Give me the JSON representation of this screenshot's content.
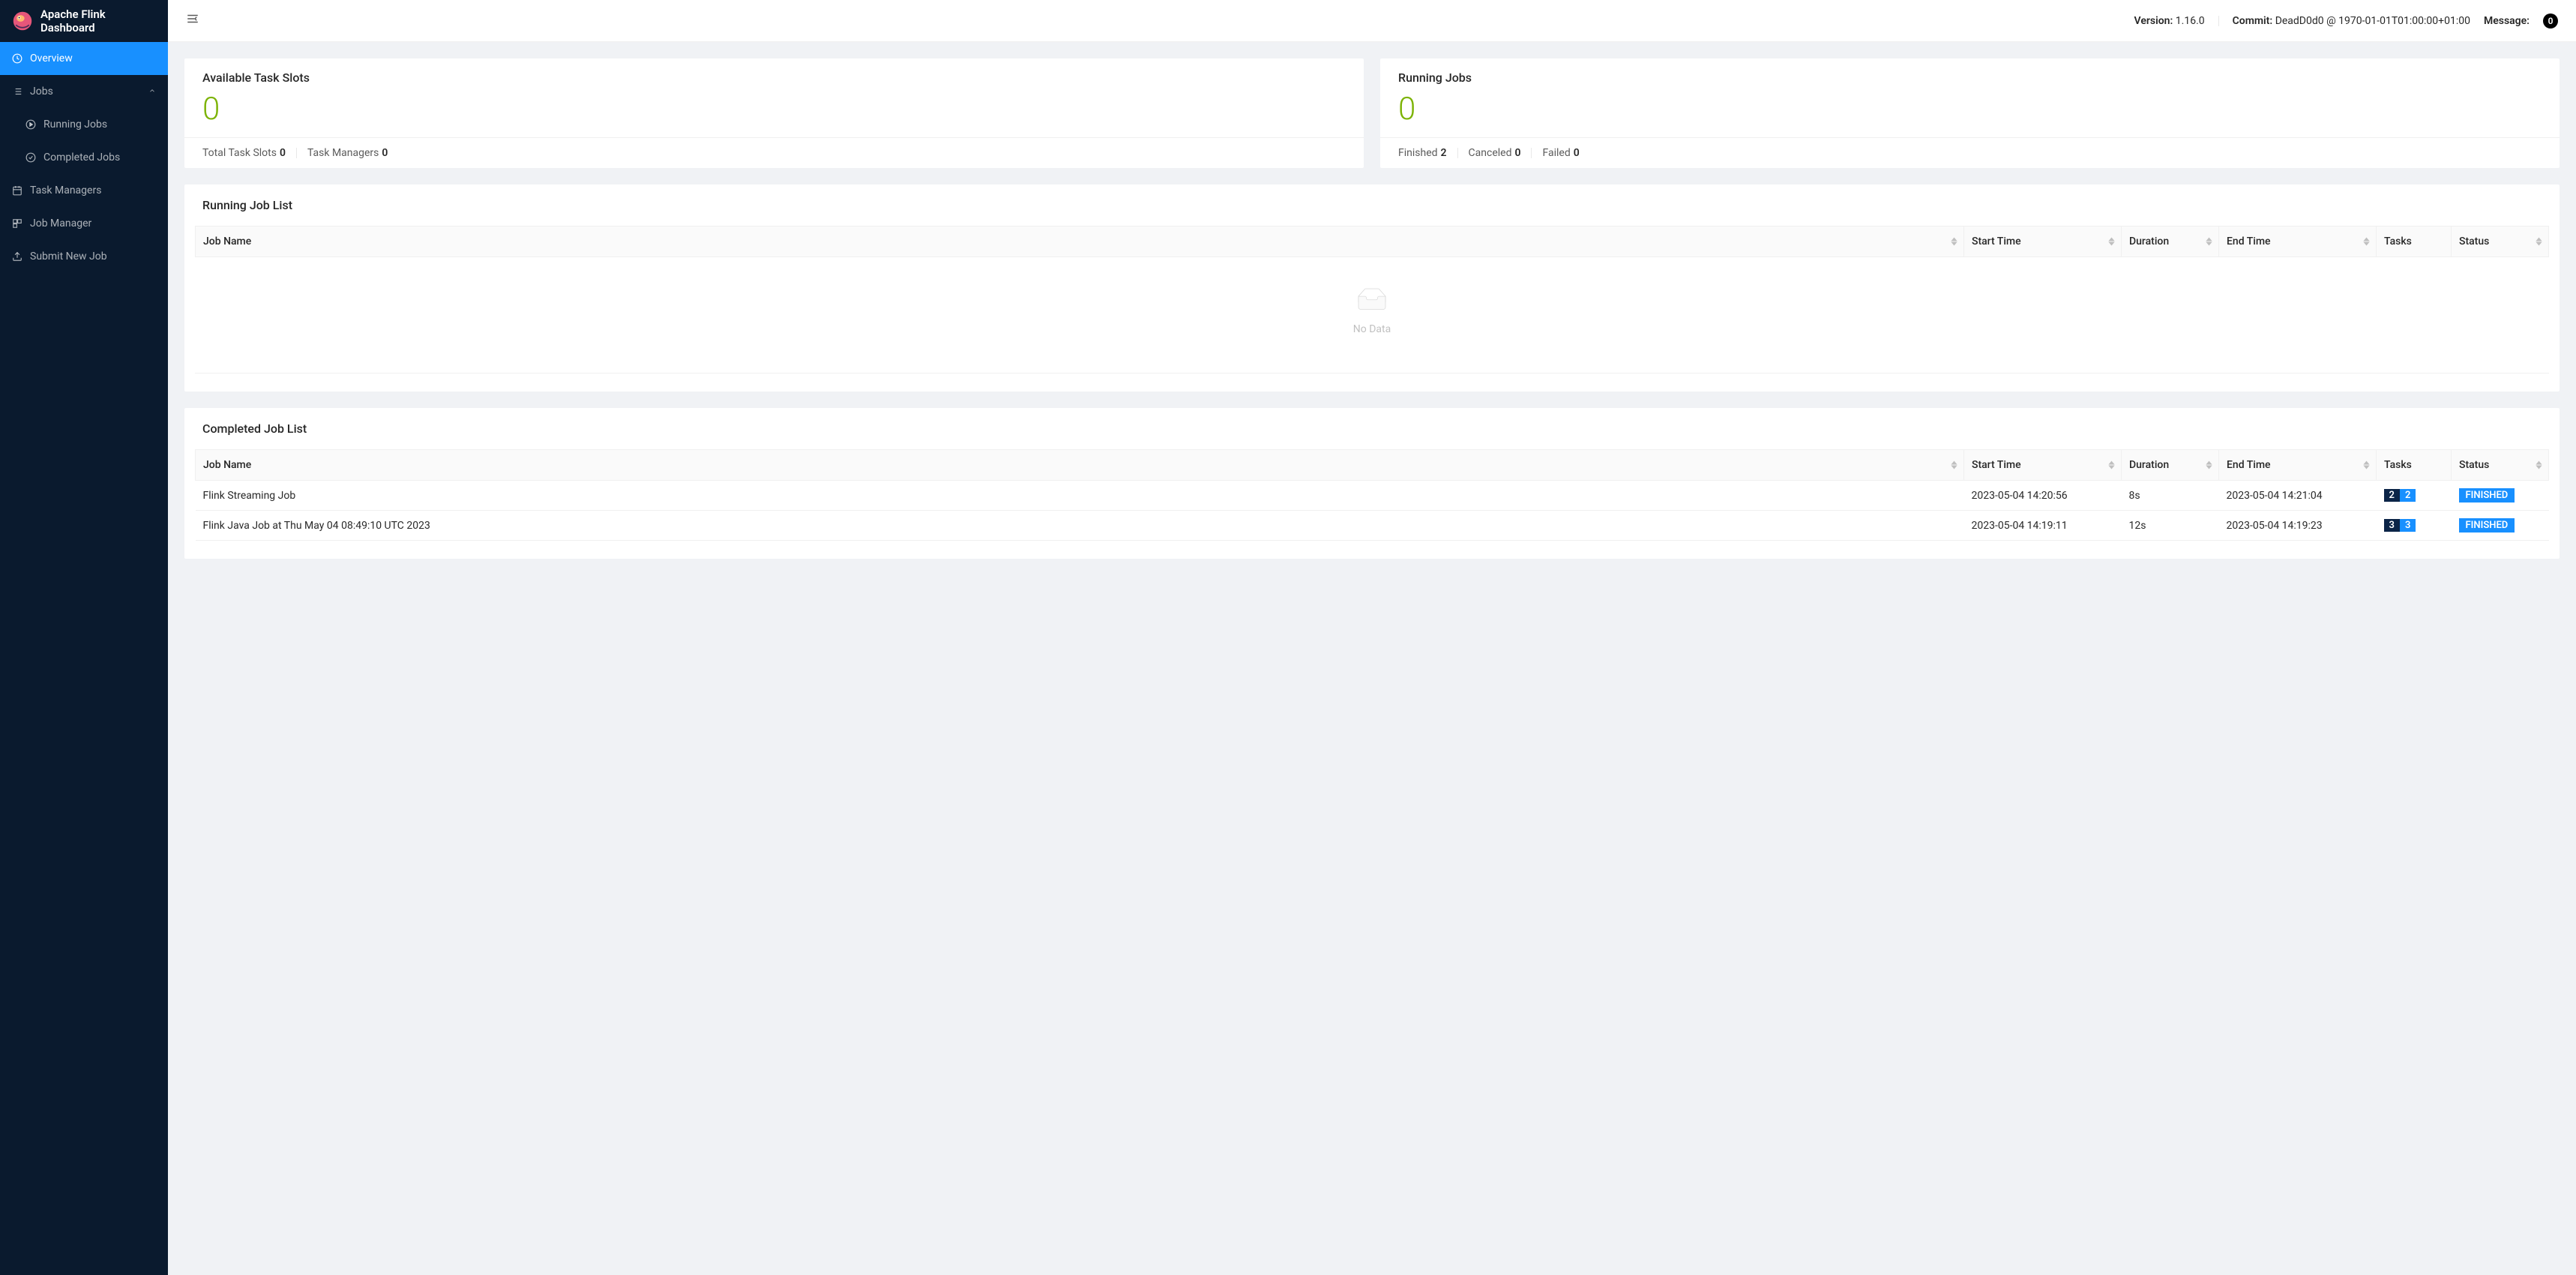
{
  "sidebar": {
    "title": "Apache Flink Dashboard",
    "items": {
      "overview": "Overview",
      "jobs": "Jobs",
      "running_jobs": "Running Jobs",
      "completed_jobs": "Completed Jobs",
      "task_managers": "Task Managers",
      "job_manager": "Job Manager",
      "submit_new_job": "Submit New Job"
    }
  },
  "topbar": {
    "version_label": "Version:",
    "version_value": "1.16.0",
    "commit_label": "Commit:",
    "commit_value": "DeadD0d0 @ 1970-01-01T01:00:00+01:00",
    "message_label": "Message:",
    "message_count": "0"
  },
  "slots_card": {
    "title": "Available Task Slots",
    "value": "0",
    "total_label": "Total Task Slots",
    "total_value": "0",
    "managers_label": "Task Managers",
    "managers_value": "0"
  },
  "running_card": {
    "title": "Running Jobs",
    "value": "0",
    "finished_label": "Finished",
    "finished_value": "2",
    "canceled_label": "Canceled",
    "canceled_value": "0",
    "failed_label": "Failed",
    "failed_value": "0"
  },
  "running_list": {
    "title": "Running Job List",
    "empty": "No Data"
  },
  "completed_list": {
    "title": "Completed Job List",
    "rows": [
      {
        "name": "Flink Streaming Job",
        "start": "2023-05-04 14:20:56",
        "duration": "8s",
        "end": "2023-05-04 14:21:04",
        "tasks_a": "2",
        "tasks_b": "2",
        "status": "FINISHED"
      },
      {
        "name": "Flink Java Job at Thu May 04 08:49:10 UTC 2023",
        "start": "2023-05-04 14:19:11",
        "duration": "12s",
        "end": "2023-05-04 14:19:23",
        "tasks_a": "3",
        "tasks_b": "3",
        "status": "FINISHED"
      }
    ]
  },
  "columns": {
    "job_name": "Job Name",
    "start_time": "Start Time",
    "duration": "Duration",
    "end_time": "End Time",
    "tasks": "Tasks",
    "status": "Status"
  }
}
